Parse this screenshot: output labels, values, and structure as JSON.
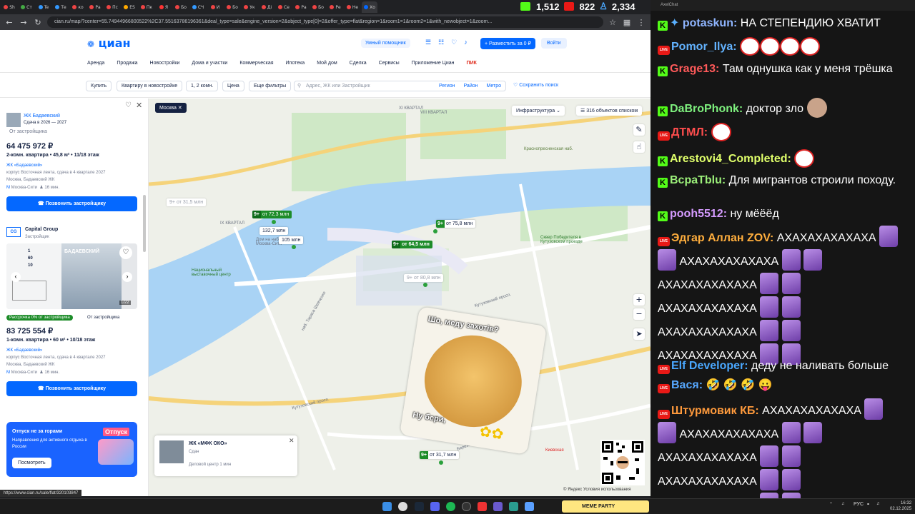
{
  "browser": {
    "tabs": [
      "Sh",
      "Ст",
      "Te",
      "Те",
      "ко",
      "Ра",
      "Пс",
      "ES",
      "Пк",
      "Я",
      "Бо",
      "СЧ",
      "И",
      "Бо",
      "Ук",
      "Ді",
      "Се",
      "Ра",
      "Бо",
      "Ре",
      "Не",
      "Хо"
    ],
    "url": "cian.ru/map/?center=55.74944966800522%2C37.55163786196361&deal_type=sale&engine_version=2&object_type[0]=2&offer_type=flat&region=1&room1=1&room2=1&with_newobject=1&zoom...",
    "status_url": "https://www.cian.ru/sale/flat/320103847"
  },
  "stream_stats": {
    "kick": "1,512",
    "live": "822",
    "viewers": "2,334"
  },
  "cian": {
    "logo": "циан",
    "assistant": "Умный помощник",
    "place_button": "+ Разместить за 0 ₽",
    "login": "Войти",
    "nav": [
      "Аренда",
      "Продажа",
      "Новостройки",
      "Дома и участки",
      "Коммерческая",
      "Ипотека",
      "Мой дом",
      "Сделка",
      "Сервисы",
      "Приложение Циан",
      "ПИК"
    ],
    "filters": {
      "buy": "Купить",
      "newbuild": "Квартиру в новостройке",
      "rooms": "1, 2 комн.",
      "price": "Цена",
      "more": "Еще фильтры",
      "search_placeholder": "Адрес, ЖК или Застройщик",
      "region": "Регион",
      "district": "Район",
      "metro": "Метро",
      "save_search": "Сохранить поиск"
    },
    "listing1": {
      "complex": "ЖК Бадаевский",
      "delivery": "Сдача в 2026 — 2027",
      "seller": "От застройщика",
      "price": "64 475 972 ₽",
      "details": "2-комн. квартира  •  45,8 м²  •  11/18 этаж",
      "jk": "ЖК «Бадаевский»",
      "corp": "корпус Восточная лента, сдача в 4 квартале 2027",
      "address": "Москва, Бадаевский ЖК",
      "metro": "Москва-Сити",
      "walk": "16 мин.",
      "call": "Позвонить застройщику"
    },
    "listing2": {
      "developer": "Capital Group",
      "developer_type": "Застройщик",
      "photo_text": "БАДАЕВСКИЙ",
      "counter": "1/22",
      "installment": "Рассрочка 0% от застройщика",
      "seller": "От застройщика",
      "price": "83 725 554 ₽",
      "details": "1-комн. квартира  •  60 м²  •  10/18 этаж",
      "jk": "ЖК «Бадаевский»",
      "corp": "корпус Восточная лента, сдача в 4 квартале 2027",
      "address": "Москва, Бадаевский ЖК",
      "metro": "Москва-Сити",
      "walk": "16 мин.",
      "call": "Позвонить застройщику"
    },
    "promo": {
      "title": "Отпуск не за горами",
      "text": "Направления для активного отдыха в России",
      "button": "Посмотреть",
      "tag": "Отпуск"
    },
    "map": {
      "chip": "Москва",
      "infra": "Инфраструктура",
      "objects": "316 объектов списком",
      "pins": [
        {
          "badge": "9+",
          "text": "от 72,3 млн"
        },
        {
          "badge": "9+",
          "text": "от 31,5 млн"
        },
        {
          "badge": "",
          "text": "132,7 млн"
        },
        {
          "badge": "",
          "text": "105 млн"
        },
        {
          "badge": "9+",
          "text": "от 75,8 млн"
        },
        {
          "badge": "9+",
          "text": "от 64,5 млн"
        },
        {
          "badge": "9+",
          "text": "от 80,8 млн"
        },
        {
          "badge": "9+",
          "text": "от 31,7 млн"
        }
      ],
      "labels": [
        "ХІ КВАРТАЛ",
        "IX КВАРТАЛ",
        "VIII КВАРТАЛ",
        "Краснопресненская наб.",
        "Кутузовский просп.",
        "наб. Тараса Шевченко",
        "Кутузовский просп.",
        "Бережковская наб.",
        "Киевская",
        "Национальный выставочный центр",
        "Сквер Победителя в Кутузовском проезде",
        "Дом на набережной Москва-Сити"
      ],
      "card": {
        "title": "ЖК «МФК ОКО»",
        "status": "Сдан",
        "metro": "Деловой центр",
        "walk": "1 мин"
      },
      "sticker_top": "Шо, меду захотів?",
      "sticker_bottom": "Ну бери,",
      "copyright": "© Яндекс Условия использования",
      "brand": "Яндекс"
    }
  },
  "chat": {
    "title": "AxelChat",
    "messages": [
      {
        "platform": "kick",
        "nick": "potaskun:",
        "color": "#8fb5ff",
        "text": "НА СТЕПЕНДИЮ ХВАТИТ"
      },
      {
        "platform": "vk",
        "nick": "Pomor_Ilya:",
        "color": "#63b3ff",
        "text": ""
      },
      {
        "platform": "kick",
        "nick": "Grage13:",
        "color": "#ff5a5a",
        "text": "Там однушка как у меня трёшка"
      },
      {
        "platform": "kick",
        "nick": "DaBroPhonk:",
        "color": "#7ef07e",
        "text": "доктор зло"
      },
      {
        "platform": "vk",
        "nick": "ДТМЛ:",
        "color": "#ff4d4d",
        "text": ""
      },
      {
        "platform": "kick",
        "nick": "Arestovi4_Completed:",
        "color": "#e0ff6b",
        "text": ""
      },
      {
        "platform": "kick",
        "nick": "BcpaTblu:",
        "color": "#9cf07a",
        "text": "Для мигрантов строили походу."
      },
      {
        "platform": "kick",
        "nick": "pooh5512:",
        "color": "#d59bff",
        "text": "ну мёёёд"
      },
      {
        "platform": "vk",
        "nick": "Эдгар Аллан ZOV:",
        "color": "#ffae3d",
        "text": "АХАХАХАХАХАХА"
      },
      {
        "platform": "vk",
        "nick": "Elf Developer:",
        "color": "#4aa8ff",
        "text": "деду не наливать больше"
      },
      {
        "platform": "vk",
        "nick": "Вася:",
        "color": "#57a8ff",
        "text": "🤣 🤣 🤣 😛"
      },
      {
        "platform": "vk",
        "nick": "Штурмовик КБ:",
        "color": "#ff9a3c",
        "text": "АХАХАХАХАХАХА"
      }
    ],
    "laugh": "АХАХАХАХАХАХА"
  },
  "taskbar": {
    "lang": "РУС",
    "time": "16:32",
    "date": "02.12.2025",
    "meme": "MEME PARTY"
  }
}
